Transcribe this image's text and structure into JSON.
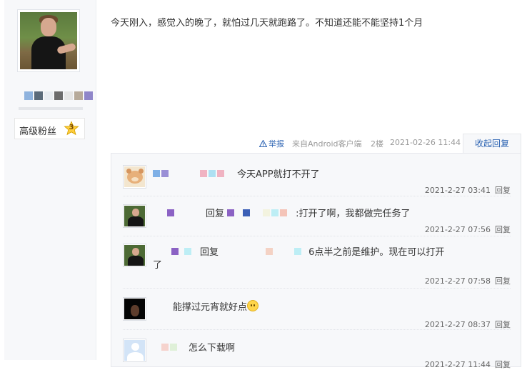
{
  "author": {
    "badge_label": "高级粉丝",
    "badge_level": "3"
  },
  "post": {
    "content": "今天刚入，感觉入的晚了，就怕过几天就跑路了。不知道还能不能坚持1个月",
    "report_label": "举报",
    "source": "来自Android客户端",
    "floor": "2楼",
    "time": "2021-02-26 11:44",
    "collapse_label": "收起回复"
  },
  "replies": [
    {
      "text": "今天APP就打不开了",
      "time": "2021-2-27 03:41",
      "reply_label": "回复"
    },
    {
      "prefix": "回复",
      "text": ":打开了啊，我都做完任务了",
      "time": "2021-2-27 07:56",
      "reply_label": "回复"
    },
    {
      "prefix": "回复",
      "text": "6点半之前是维护。现在可以打开",
      "text_line2": "了",
      "time": "2021-2-27 07:58",
      "reply_label": "回复"
    },
    {
      "text": "能撑过元宵就好点",
      "time": "2021-2-27 08:37",
      "reply_label": "回复"
    },
    {
      "text": "怎么下载啊",
      "time": "2021-2-27 11:44",
      "reply_label": "回复"
    }
  ],
  "colors": {
    "link": "#2d64b3",
    "panel_bg": "#f7f8fa"
  }
}
